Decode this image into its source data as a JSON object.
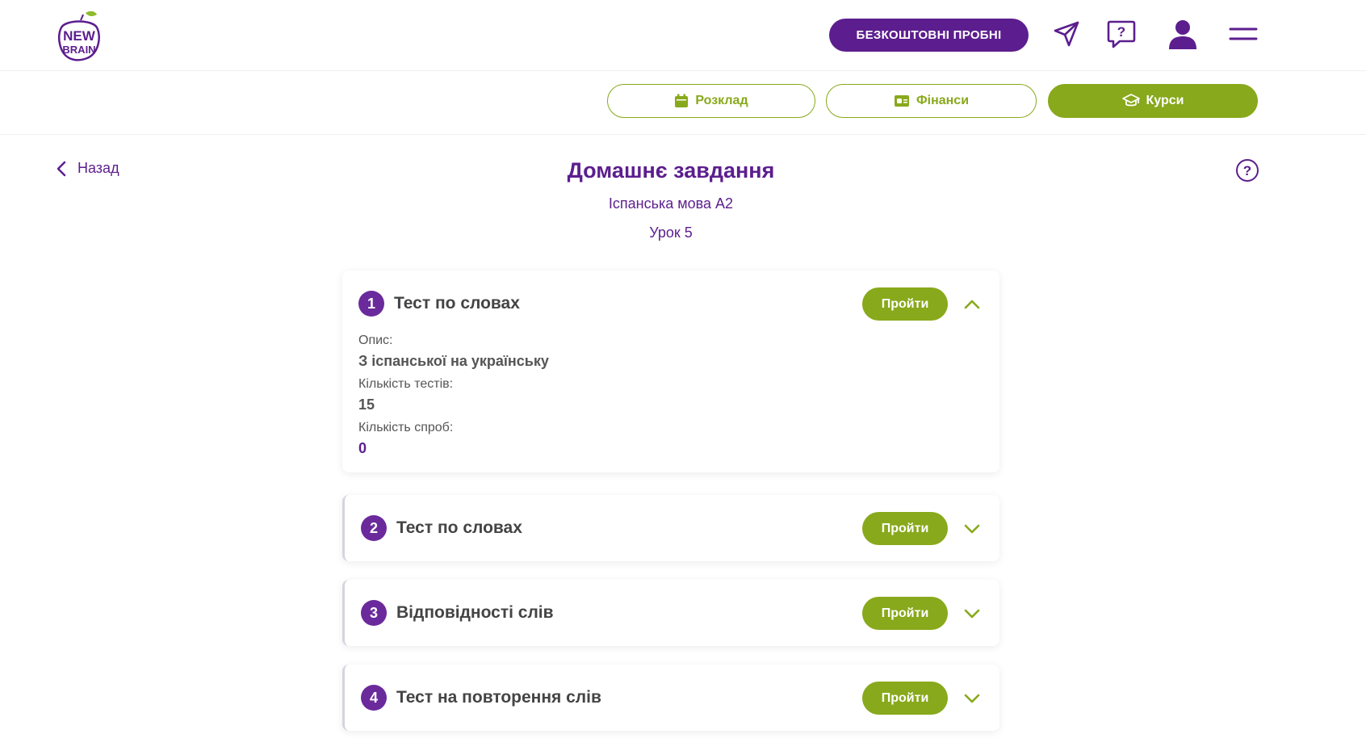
{
  "header": {
    "logo_text_top": "NEW",
    "logo_text_bottom": "BRAIN",
    "trial_button": "БЕЗКОШТОВНІ ПРОБНІ",
    "icons": [
      "paper-plane-icon",
      "question-chat-icon",
      "user-icon",
      "menu-icon"
    ]
  },
  "subnav": {
    "schedule": "Розклад",
    "finance": "Фінанси",
    "courses": "Курси"
  },
  "page": {
    "back_label": "Назад",
    "title": "Домашнє завдання",
    "course": "Іспанська мова А2",
    "lesson": "Урок 5"
  },
  "tasks": [
    {
      "number": "1",
      "title": "Тест по словах",
      "button": "Пройти",
      "expanded": true,
      "details": {
        "desc_label": "Опис:",
        "desc_value": "З іспанської на українську",
        "tests_label": "Кількість тестів:",
        "tests_value": "15",
        "attempts_label": "Кількість спроб:",
        "attempts_value": "0"
      }
    },
    {
      "number": "2",
      "title": "Тест по словах",
      "button": "Пройти",
      "expanded": false
    },
    {
      "number": "3",
      "title": "Відповідності слів",
      "button": "Пройти",
      "expanded": false
    },
    {
      "number": "4",
      "title": "Тест на повторення слів",
      "button": "Пройти",
      "expanded": false
    }
  ],
  "colors": {
    "primary_purple": "#5c1e8e",
    "accent_green": "#88a91b",
    "leaf_green": "#8dbb2a"
  }
}
